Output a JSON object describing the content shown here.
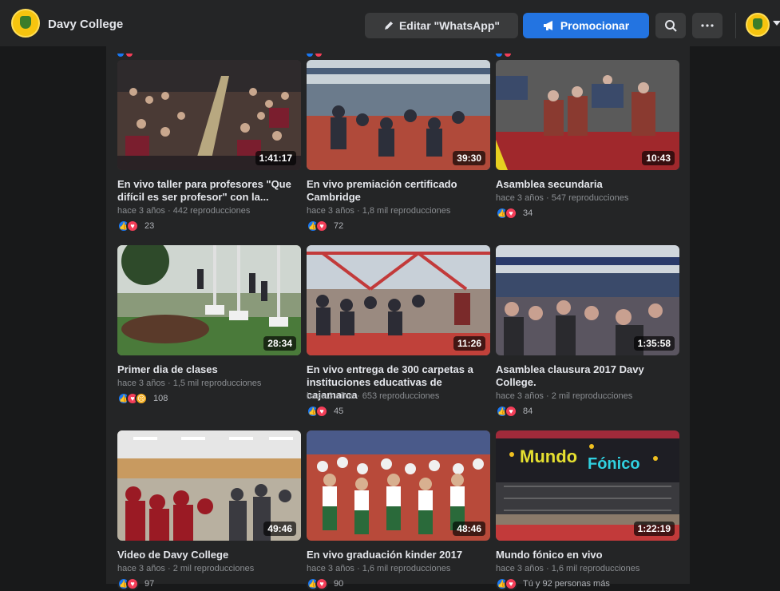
{
  "header": {
    "page_name": "Davy College",
    "edit_label": "Editar \"WhatsApp\"",
    "promote_label": "Promocionar"
  },
  "videos": [
    {
      "title": "En vivo taller para profesores \"Que difícil es ser profesor\" con la...",
      "meta": "hace 3 años · 442 reproducciones",
      "duration": "1:41:17",
      "reactions": [
        "like",
        "love"
      ],
      "count": "23"
    },
    {
      "title": "En vivo premiación certificado Cambridge",
      "meta": "hace 3 años · 1,8 mil reproducciones",
      "duration": "39:30",
      "reactions": [
        "like",
        "love"
      ],
      "count": "72"
    },
    {
      "title": "Asamblea secundaria",
      "meta": "hace 3 años · 547 reproducciones",
      "duration": "10:43",
      "reactions": [
        "like",
        "love"
      ],
      "count": "34"
    },
    {
      "title": "Primer dia de clases",
      "meta": "hace 3 años · 1,5 mil reproducciones",
      "duration": "28:34",
      "reactions": [
        "like",
        "love",
        "sad"
      ],
      "count": "108"
    },
    {
      "title": "En vivo entrega de 300 carpetas a instituciones educativas de cajamarca",
      "meta": "hace 3 años · 653 reproducciones",
      "duration": "11:26",
      "reactions": [
        "like",
        "love"
      ],
      "count": "45"
    },
    {
      "title": "Asamblea clausura 2017 Davy College.",
      "meta": "hace 3 años · 2 mil reproducciones",
      "duration": "1:35:58",
      "reactions": [
        "like",
        "love"
      ],
      "count": "84"
    },
    {
      "title": "Video de Davy College",
      "meta": "hace 3 años · 2 mil reproducciones",
      "duration": "49:46",
      "reactions": [
        "like",
        "love"
      ],
      "count": "97"
    },
    {
      "title": "En vivo graduación kinder 2017",
      "meta": "hace 3 años · 1,6 mil reproducciones",
      "duration": "48:46",
      "reactions": [
        "like",
        "love"
      ],
      "count": "90"
    },
    {
      "title": "Mundo fónico en vivo",
      "meta": "hace 3 años · 1,6 mil reproducciones",
      "duration": "1:22:19",
      "reactions": [
        "like",
        "love"
      ],
      "count": "Tú y 92 personas más"
    }
  ],
  "colors": {
    "background": "#18191a",
    "panel": "#242526",
    "accent": "#2374e1",
    "like": "#1877f2",
    "love": "#f33e58"
  }
}
